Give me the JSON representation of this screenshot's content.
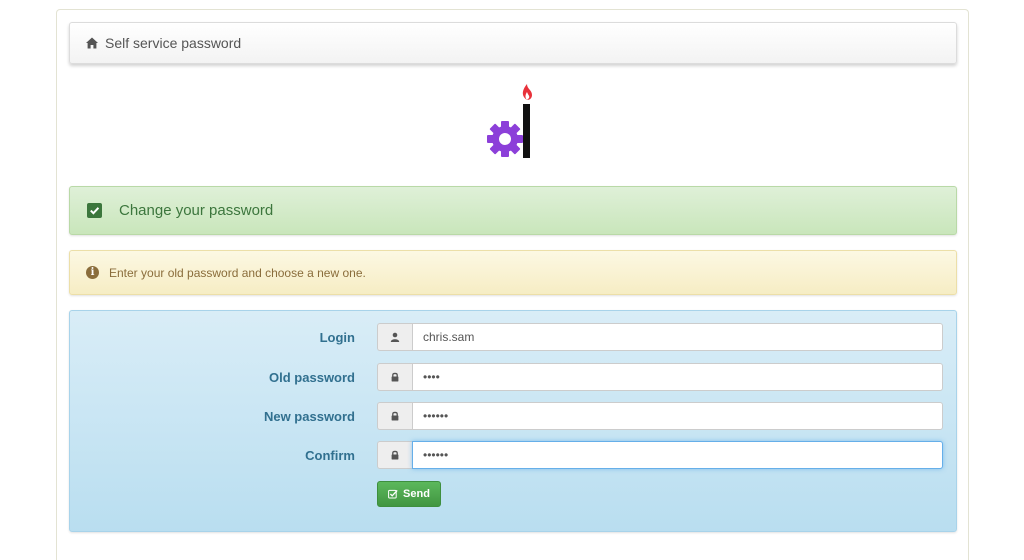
{
  "navbar": {
    "brand": "Self service password",
    "icon": "home-icon"
  },
  "logo": {
    "icon": "ltb-logo",
    "colors": {
      "gear": "#8c3fd9",
      "flame": "#e8313a",
      "bar": "#111111"
    }
  },
  "success_alert": {
    "icon": "check-square-icon",
    "title": "Change your password"
  },
  "warning_alert": {
    "icon": "info-circle-icon",
    "message": "Enter your old password and choose a new one."
  },
  "form": {
    "fields": [
      {
        "label": "Login",
        "icon": "user-icon",
        "value": "chris.sam",
        "type": "text"
      },
      {
        "label": "Old password",
        "icon": "lock-icon",
        "value": "••••",
        "type": "password"
      },
      {
        "label": "New password",
        "icon": "lock-icon",
        "value": "••••••",
        "type": "password"
      },
      {
        "label": "Confirm",
        "icon": "lock-icon",
        "value": "••••••",
        "type": "password"
      }
    ],
    "submit_label": "Send"
  },
  "colors": {
    "success_text": "#3c763d",
    "warning_text": "#8a6d3b",
    "info_label": "#31708f",
    "button_green": "#5cb85c"
  }
}
